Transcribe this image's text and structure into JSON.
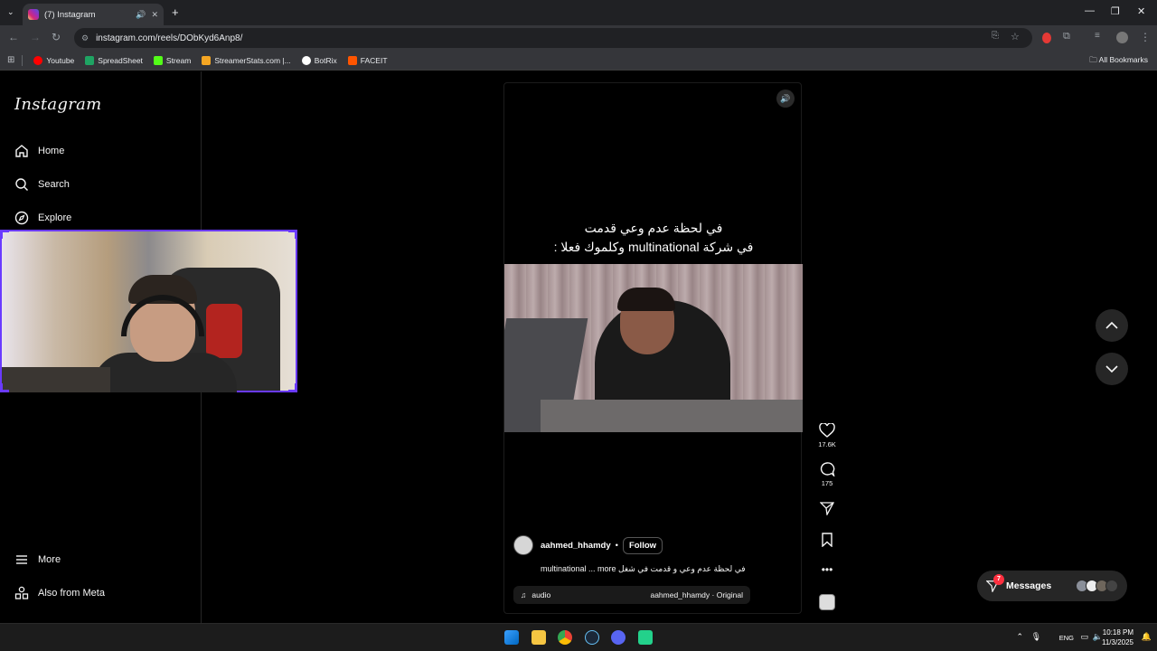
{
  "browser": {
    "tab_title": "(7) Instagram",
    "url": "instagram.com/reels/DObKyd6Anp8/",
    "bookmarks": [
      {
        "label": "Youtube",
        "color": "#ff0000"
      },
      {
        "label": "SpreadSheet",
        "color": "#1fa463"
      },
      {
        "label": "Stream",
        "color": "#53fc18"
      },
      {
        "label": "StreamerStats.com |...",
        "color": "#f5a623"
      },
      {
        "label": "BotRix",
        "color": "#ffffff"
      },
      {
        "label": "FACEIT",
        "color": "#ff5500"
      }
    ],
    "all_bookmarks": "All Bookmarks"
  },
  "sidebar": {
    "logo": "Instagram",
    "items": [
      {
        "label": "Home",
        "icon": "home-icon"
      },
      {
        "label": "Search",
        "icon": "search-icon"
      },
      {
        "label": "Explore",
        "icon": "compass-icon"
      }
    ],
    "bottom_items": [
      {
        "label": "More",
        "icon": "menu-icon"
      },
      {
        "label": "Also from Meta",
        "icon": "meta-apps-icon"
      }
    ]
  },
  "reel": {
    "overlay_line1": "في لحظة عدم وعي قدمت",
    "overlay_line2": "في شركة multinational وكلموك فعلا :",
    "author": "aahmed_hhamdy",
    "follow_label": "Follow",
    "caption": "في لحظة عدم وعي و قدمت في شغل multinational ... more",
    "audio_label": "audio",
    "audio_source": "aahmed_hhamdy · Original",
    "likes": "17.6K",
    "comments": "175"
  },
  "messages": {
    "label": "Messages",
    "badge": "7"
  },
  "taskbar": {
    "lang": "ENG",
    "time": "10:18 PM",
    "date": "11/3/2025"
  }
}
